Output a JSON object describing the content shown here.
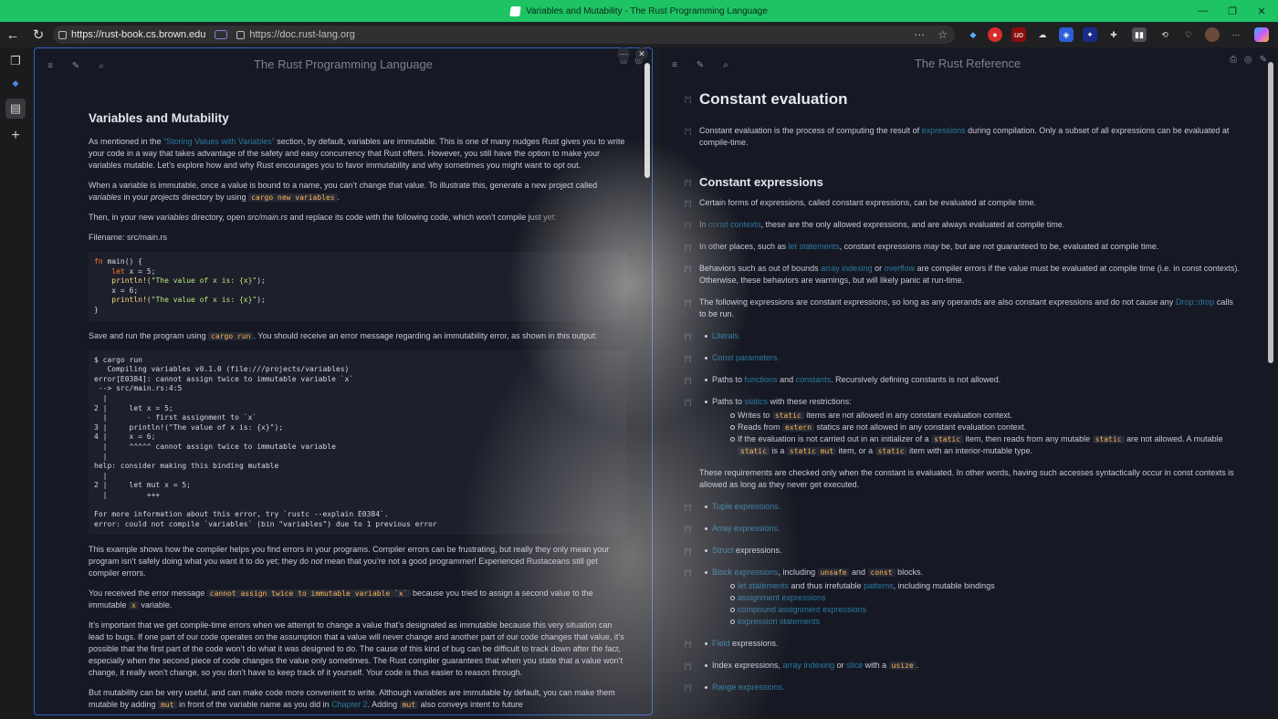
{
  "window": {
    "title": "Variables and Mutability - The Rust Programming Language"
  },
  "address": {
    "left_url": "https://rust-book.cs.brown.edu",
    "right_url": "https://doc.rust-lang.org"
  },
  "left": {
    "pane_title": "The Rust Programming Language",
    "heading": "Variables and Mutability",
    "p1a": "As mentioned in the ",
    "p1link": "“Storing Values with Variables”",
    "p1b": " section, by default, variables are immutable. This is one of many nudges Rust gives you to write your code in a way that takes advantage of the safety and easy concurrency that Rust offers. However, you still have the option to make your variables mutable. Let’s explore how and why Rust encourages you to favor immutability and why sometimes you might want to opt out.",
    "p2a": "When a variable is immutable, once a value is bound to a name, you can’t change that value. To illustrate this, generate a new project called ",
    "p2em": "variables",
    "p2b": " in your ",
    "p2em2": "projects",
    "p2c": " directory by using ",
    "p2code": "cargo new variables",
    "p2d": ".",
    "p3a": "Then, in your new ",
    "p3em": "variables",
    "p3b": " directory, open ",
    "p3em2": "src/main.rs",
    "p3c": " and replace its code with the following code, which won’t compile just yet:",
    "filename": "Filename: src/main.rs",
    "p4a": "Save and run the program using ",
    "p4code": "cargo run",
    "p4b": ". You should receive an error message regarding an immutability error, as shown in this output:",
    "p5a": "This example shows how the compiler helps you find errors in your programs. Compiler errors can be frustrating, but really they only mean your program isn’t safely doing what you want it to do yet; they do ",
    "p5em": "not",
    "p5b": " mean that you’re not a good programmer! Experienced Rustaceans still get compiler errors.",
    "p6a": "You received the error message ",
    "p6code": "cannot assign twice to immutable variable `x`",
    "p6b": " because you tried to assign a second value to the immutable ",
    "p6code2": "x",
    "p6c": " variable.",
    "p7": "It’s important that we get compile-time errors when we attempt to change a value that’s designated as immutable because this very situation can lead to bugs. If one part of our code operates on the assumption that a value will never change and another part of our code changes that value, it’s possible that the first part of the code won’t do what it was designed to do. The cause of this kind of bug can be difficult to track down after the fact, especially when the second piece of code changes the value only sometimes. The Rust compiler guarantees that when you state that a value won’t change, it really won’t change, so you don’t have to keep track of it yourself. Your code is thus easier to reason through.",
    "p8a": "But mutability can be very useful, and can make code more convenient to write. Although variables are immutable by default, you can make them mutable by adding ",
    "p8code": "mut",
    "p8b": " in front of the variable name as you did in ",
    "p8link": "Chapter 2",
    "p8c": ". Adding ",
    "p8code2": "mut",
    "p8d": " also conveys intent to future"
  },
  "right": {
    "pane_title": "The Rust Reference",
    "marker": "[*]",
    "h1": "Constant evaluation",
    "r1a": "Constant evaluation is the process of computing the result of ",
    "r1link": "expressions",
    "r1b": " during compilation. Only a subset of all expressions can be evaluated at compile-time.",
    "h2": "Constant expressions",
    "r2": "Certain forms of expressions, called constant expressions, can be evaluated at compile time.",
    "r3a": "In ",
    "r3link": "const contexts",
    "r3b": ", these are the only allowed expressions, and are always evaluated at compile time.",
    "r4a": "In other places, such as ",
    "r4link": "let statements",
    "r4b": ", constant expressions ",
    "r4em": "may",
    "r4c": " be, but are not guaranteed to be, evaluated at compile time.",
    "r5a": "Behaviors such as out of bounds ",
    "r5link": "array indexing",
    "r5b": " or ",
    "r5link2": "overflow",
    "r5c": " are compiler errors if the value must be evaluated at compile time (i.e. in const contexts). Otherwise, these behaviors are warnings, but will likely panic at run-time.",
    "r6a": "The following expressions are constant expressions, so long as any operands are also constant expressions and do not cause any ",
    "r6link": "Drop::drop",
    "r6b": " calls to be run.",
    "b1": "Literals.",
    "b2": "Const parameters.",
    "b3a": "Paths to ",
    "b3l1": "functions",
    "b3b": " and ",
    "b3l2": "constants",
    "b3c": ". Recursively defining constants is not allowed.",
    "b4a": "Paths to ",
    "b4l": "statics",
    "b4b": " with these restrictions:",
    "s1a": "Writes to ",
    "s1c": "static",
    "s1b": " items are not allowed in any constant evaluation context.",
    "s2a": "Reads from ",
    "s2c": "extern",
    "s2b": " statics are not allowed in any constant evaluation context.",
    "s3a": "If the evaluation is not carried out in an initializer of a ",
    "s3c": "static",
    "s3b": " item, then reads from any mutable ",
    "s3c2": "static",
    "s3d": " are not allowed. A mutable ",
    "s3c3": "static",
    "s3e": " is a ",
    "s3c4": "static mut",
    "s3f": " item, or a ",
    "s3c5": "static",
    "s3g": " item with an interior-mutable type.",
    "r7": "These requirements are checked only when the constant is evaluated. In other words, having such accesses syntactically occur in const contexts is allowed as long as they never get executed.",
    "b5": "Tuple expressions.",
    "b6": "Array expressions.",
    "b7a": "Struct",
    "b7b": " expressions.",
    "b8a": "Block expressions",
    "b8b": ", including ",
    "b8c": "unsafe",
    "b8d": " and ",
    "b8e": "const",
    "b8f": " blocks.",
    "s4a": "let statements",
    "s4b": " and thus irrefutable ",
    "s4c": "patterns",
    "s4d": ", including mutable bindings",
    "s5": "assignment expressions",
    "s6": "compound assignment expressions",
    "s7": "expression statements",
    "b9a": "Field",
    "b9b": " expressions.",
    "b10a": "Index expressions, ",
    "b10l": "array indexing",
    "b10b": " or ",
    "b10l2": "slice",
    "b10c": " with a ",
    "b10d": "usize",
    "b10e": ".",
    "b11": "Range expressions."
  }
}
